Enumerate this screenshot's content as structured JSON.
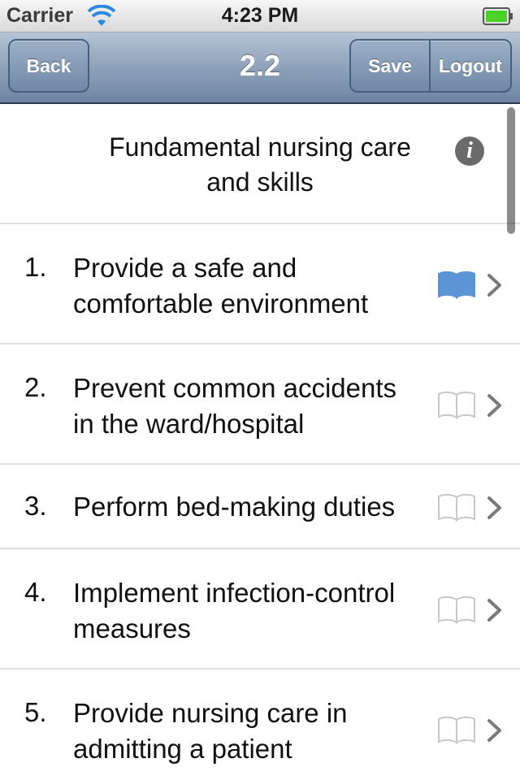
{
  "status_bar": {
    "carrier": "Carrier",
    "time": "4:23 PM",
    "battery_color": "#4cd12a"
  },
  "nav_bar": {
    "back_label": "Back",
    "title": "2.2",
    "save_label": "Save",
    "logout_label": "Logout"
  },
  "section": {
    "title": "Fundamental nursing care\nand skills",
    "info_icon": "info-icon"
  },
  "items": [
    {
      "number": "1.",
      "text": "Provide a safe and\ncomfortable environment",
      "book_highlighted": true
    },
    {
      "number": "2.",
      "text": "Prevent common accidents\nin the ward/hospital",
      "book_highlighted": false
    },
    {
      "number": "3.",
      "text": "Perform bed-making duties",
      "book_highlighted": false
    },
    {
      "number": "4.",
      "text": "Implement infection-control\nmeasures",
      "book_highlighted": false
    },
    {
      "number": "5.",
      "text": "Provide nursing care in\nadmitting a patient",
      "book_highlighted": false
    }
  ],
  "colors": {
    "book_active": "#5b95d6",
    "book_inactive": "#c8c8c8",
    "chevron": "#7a7a7a"
  }
}
